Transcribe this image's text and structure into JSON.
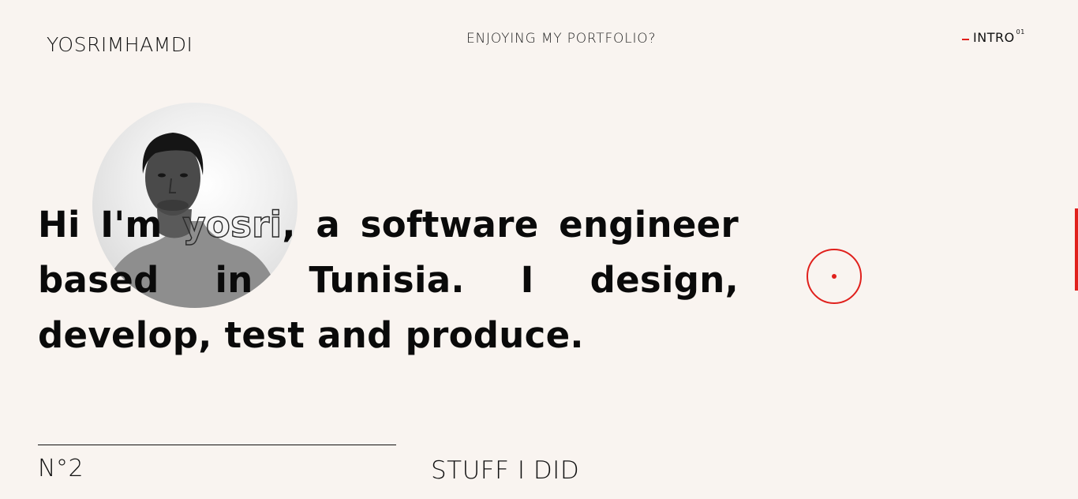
{
  "header": {
    "brand": "YOSRIMHAMDI",
    "tagline": "ENJOYING MY PORTFOLIO?",
    "section_label": "INTRO",
    "section_number": "01"
  },
  "hero": {
    "before_name": "Hi I'm ",
    "name": "yosri",
    "after_name": ", a software engineer based in Tunisia. I design, develop, test and produce."
  },
  "next_section": {
    "number": "N°2",
    "title": "STUFF I DID"
  },
  "colors": {
    "background": "#f9f4f0",
    "accent": "#e0201c",
    "text": "#111111"
  }
}
